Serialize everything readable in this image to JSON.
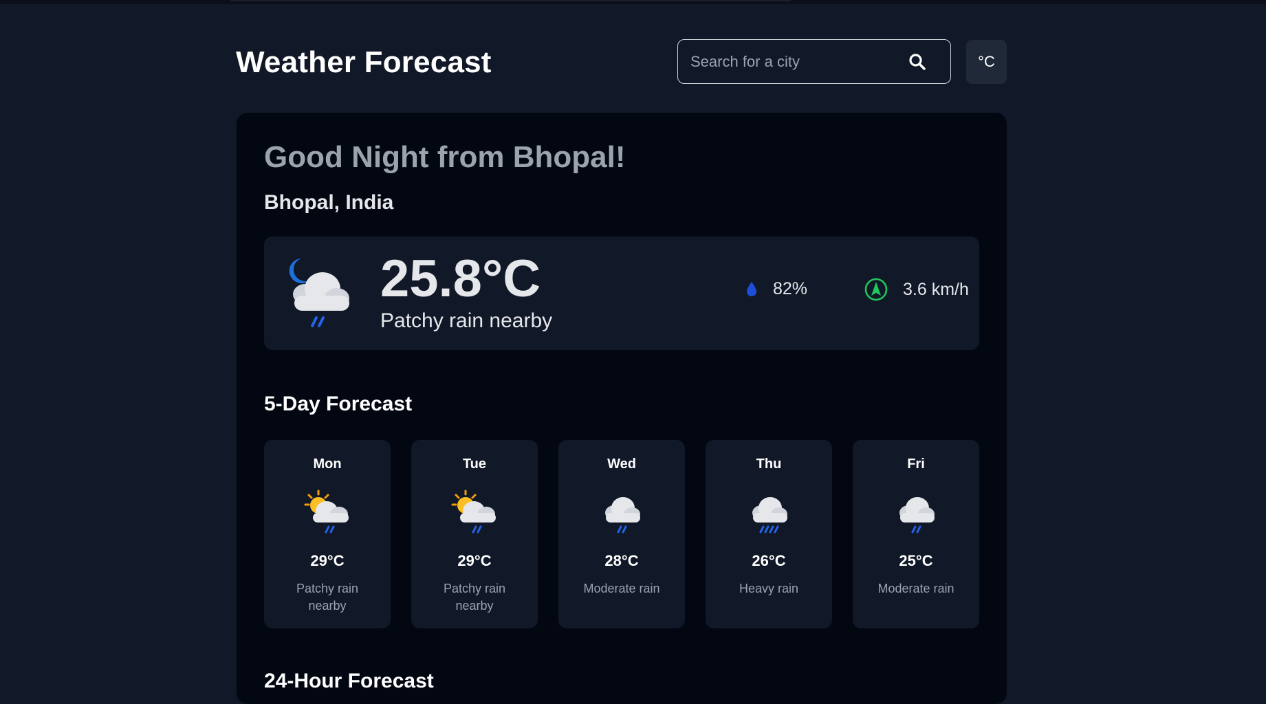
{
  "header": {
    "title": "Weather Forecast",
    "search_placeholder": "Search for a city",
    "unit_label": "°C"
  },
  "current": {
    "greeting": "Good Night from Bhopal!",
    "location": "Bhopal, India",
    "temperature": "25.8°C",
    "condition": "Patchy rain nearby",
    "condition_icon": "moon-cloud-rain-icon",
    "humidity": "82%",
    "wind": "3.6 km/h"
  },
  "forecast": {
    "title": "5-Day Forecast",
    "days": [
      {
        "day": "Mon",
        "temp": "29°C",
        "desc": "Patchy rain nearby",
        "icon": "sun-cloud-rain-icon"
      },
      {
        "day": "Tue",
        "temp": "29°C",
        "desc": "Patchy rain nearby",
        "icon": "sun-cloud-rain-icon"
      },
      {
        "day": "Wed",
        "temp": "28°C",
        "desc": "Moderate rain",
        "icon": "cloud-rain-icon"
      },
      {
        "day": "Thu",
        "temp": "26°C",
        "desc": "Heavy rain",
        "icon": "cloud-heavy-rain-icon"
      },
      {
        "day": "Fri",
        "temp": "25°C",
        "desc": "Moderate rain",
        "icon": "cloud-rain-icon"
      }
    ]
  },
  "hourly": {
    "title": "24-Hour Forecast"
  },
  "colors": {
    "background": "#111827",
    "card": "#030712",
    "panel": "#111827",
    "humidity_accent": "#1d4ed8",
    "wind_accent": "#22c55e",
    "rain_accent": "#3b82f6",
    "sun_accent": "#fbbf24"
  }
}
